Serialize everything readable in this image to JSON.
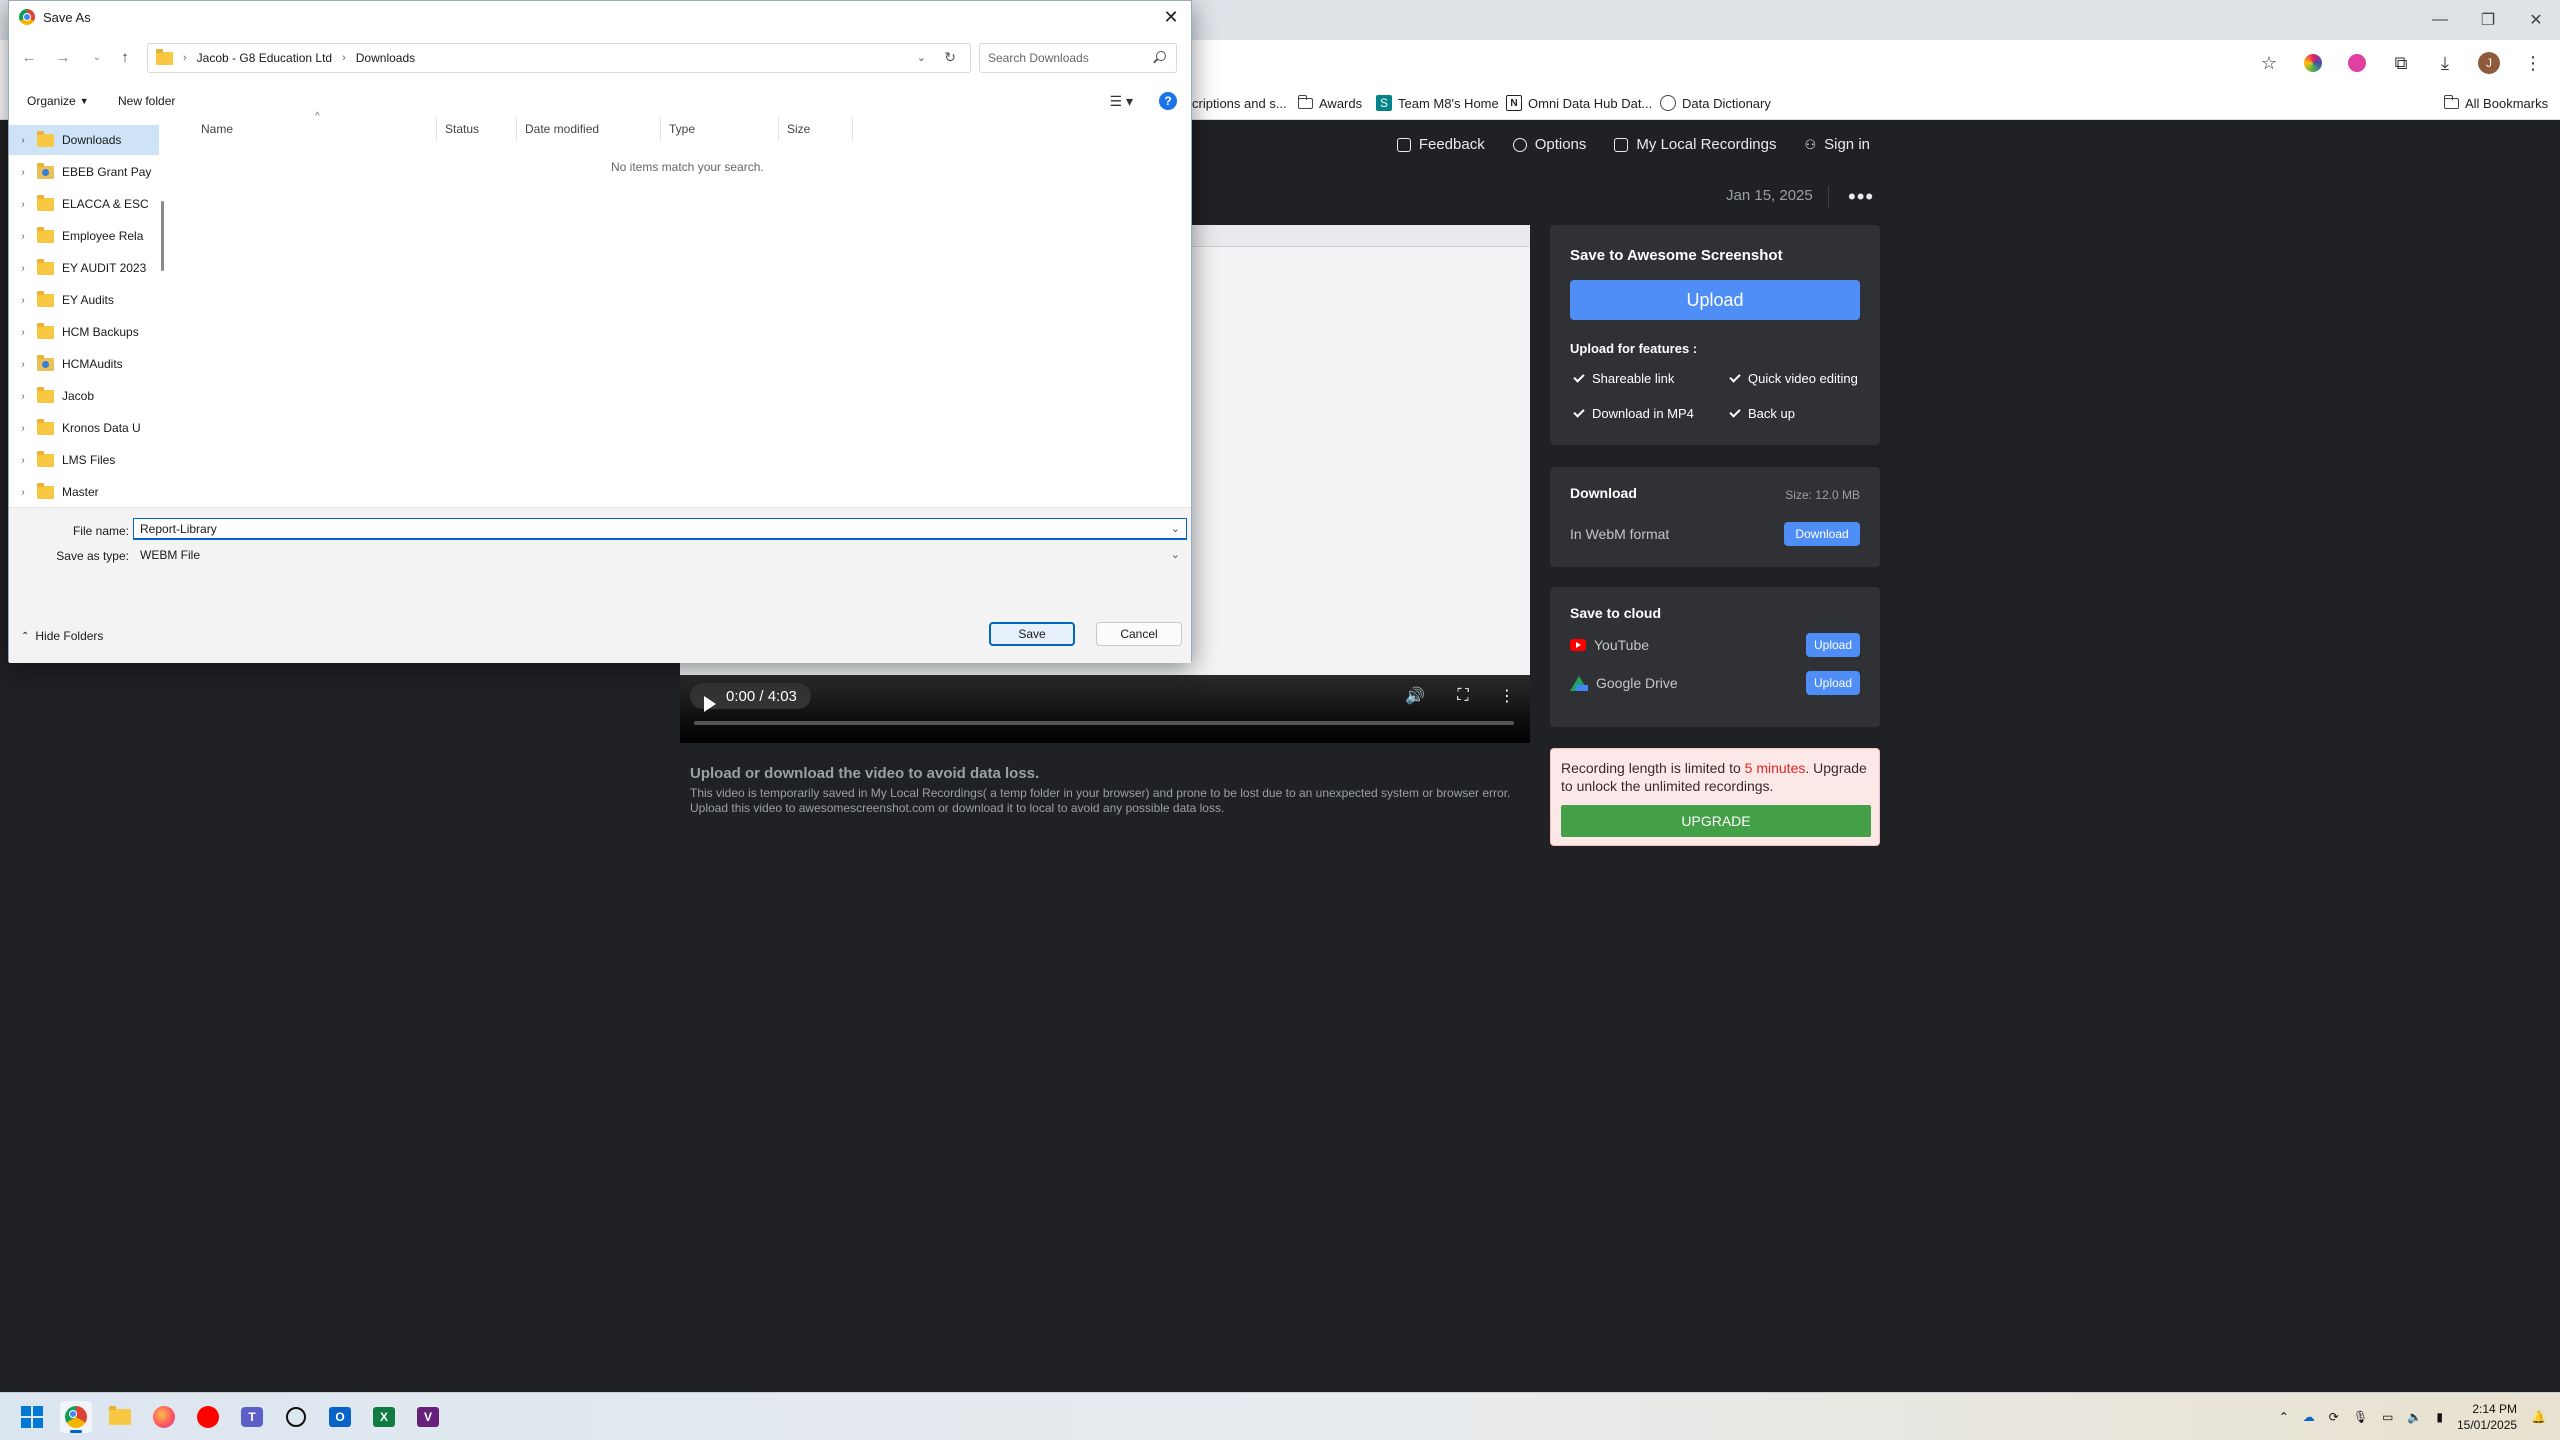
{
  "browser": {
    "window_controls": [
      "—",
      "❐",
      "✕"
    ],
    "bookmarks": [
      {
        "label": "criptions and s...",
        "icon": "folder"
      },
      {
        "label": "Awards",
        "icon": "folder"
      },
      {
        "label": "Team M8's Home",
        "icon": "team-site"
      },
      {
        "label": "Omni Data Hub Dat...",
        "icon": "notion"
      },
      {
        "label": "Data Dictionary",
        "icon": "globe"
      }
    ],
    "all_bookmarks": "All Bookmarks",
    "avatar_letter": "J"
  },
  "page": {
    "nav": {
      "feedback": "Feedback",
      "options": "Options",
      "recordings": "My Local Recordings",
      "sign_in": "Sign in"
    },
    "date": "Jan 15, 2025",
    "more": "•••",
    "video": {
      "time": "0:00 / 4:03",
      "progress": 0.0
    },
    "notice_title": "Upload or download the video to avoid data loss.",
    "notice_text": "This video is temporarily saved in My Local Recordings( a temp folder in your browser) and prone to be lost due to an unexpected system or browser error. Upload this video to awesomescreenshot.com or download it to local to avoid any possible data loss.",
    "save_panel": {
      "title": "Save to Awesome Screenshot",
      "upload_label": "Upload",
      "features_title": "Upload for features :",
      "features": [
        "Shareable link",
        "Quick video editing",
        "Download in MP4",
        "Back up"
      ]
    },
    "download_panel": {
      "title": "Download",
      "size": "Size: 12.0 MB",
      "format": "In WebM format",
      "button": "Download"
    },
    "cloud_panel": {
      "title": "Save to cloud",
      "youtube": "YouTube",
      "drive": "Google Drive",
      "button": "Upload"
    },
    "upgrade": {
      "text_before": "Recording length is limited to ",
      "limit": "5 minutes",
      "text_after": ". Upgrade to unlock the unlimited recordings.",
      "button": "UPGRADE"
    }
  },
  "dialog": {
    "title": "Save As",
    "breadcrumb": [
      "Jacob - G8 Education Ltd",
      "Downloads"
    ],
    "search_placeholder": "Search Downloads",
    "organize": "Organize",
    "new_folder": "New folder",
    "tree": [
      {
        "label": "Downloads",
        "selected": true,
        "shared": false
      },
      {
        "label": "EBEB Grant Pay",
        "selected": false,
        "shared": true
      },
      {
        "label": "ELACCA & ESC",
        "selected": false,
        "shared": false
      },
      {
        "label": "Employee Rela",
        "selected": false,
        "shared": false
      },
      {
        "label": "EY AUDIT 2023",
        "selected": false,
        "shared": false
      },
      {
        "label": "EY Audits",
        "selected": false,
        "shared": false
      },
      {
        "label": "HCM Backups",
        "selected": false,
        "shared": false
      },
      {
        "label": "HCMAudits",
        "selected": false,
        "shared": true
      },
      {
        "label": "Jacob",
        "selected": false,
        "shared": false
      },
      {
        "label": "Kronos Data U",
        "selected": false,
        "shared": false
      },
      {
        "label": "LMS Files",
        "selected": false,
        "shared": false
      },
      {
        "label": "Master",
        "selected": false,
        "shared": false
      }
    ],
    "columns": [
      "Name",
      "Status",
      "Date modified",
      "Type",
      "Size"
    ],
    "empty_message": "No items match your search.",
    "file_name_label": "File name:",
    "file_name_value": "Report-Library",
    "save_type_label": "Save as type:",
    "save_type_value": "WEBM File",
    "hide_folders": "Hide Folders",
    "save": "Save",
    "cancel": "Cancel"
  },
  "taskbar": {
    "apps": [
      "start",
      "chrome",
      "file-explorer",
      "firefox",
      "youtube-music",
      "teams",
      "chatgpt",
      "outlook",
      "excel",
      "visual-studio"
    ],
    "time": "2:14 PM",
    "date": "15/01/2025"
  },
  "colors": {
    "accent_blue": "#4f8df7",
    "upgrade_green": "#43a047",
    "limit_red": "#e02424",
    "page_bg": "#202124",
    "panel_bg": "#303134"
  }
}
